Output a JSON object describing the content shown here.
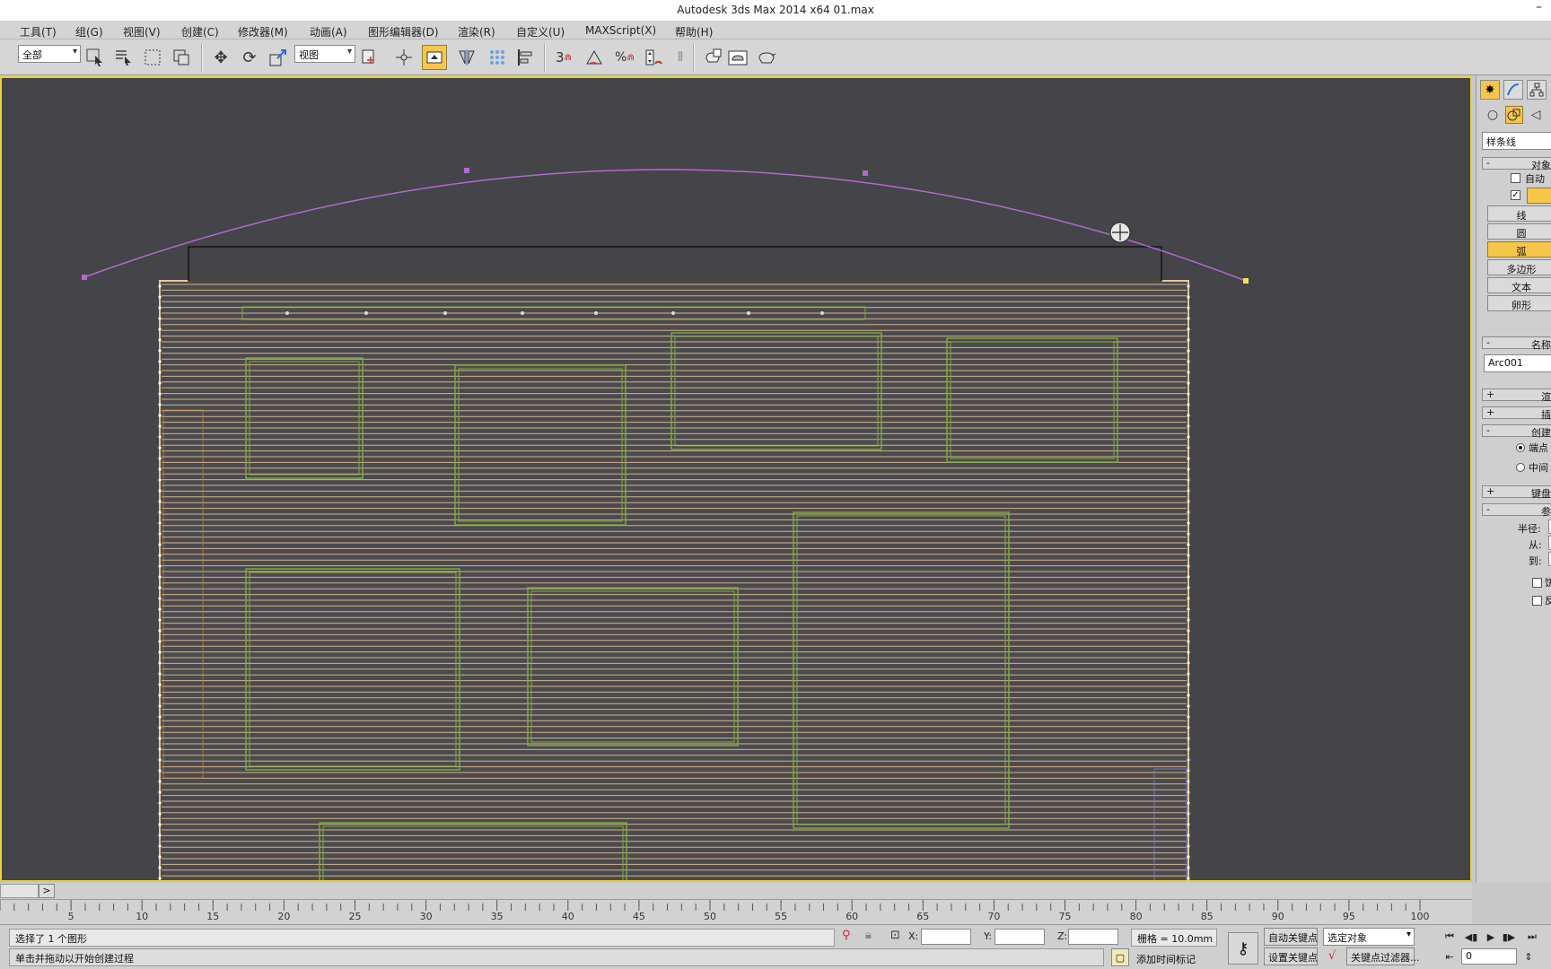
{
  "titlebar": {
    "title": "Autodesk 3ds Max  2014 x64      01.max",
    "minimize": "–"
  },
  "menu": [
    "工具(T)",
    "组(G)",
    "视图(V)",
    "创建(C)",
    "修改器(M)",
    "动画(A)",
    "图形编辑器(D)",
    "渲染(R)",
    "自定义(U)",
    "MAXScript(X)",
    "帮助(H)"
  ],
  "toolbar": {
    "selection_filter": "全部",
    "ref_coord": "视图"
  },
  "command_panel": {
    "category": "样条线",
    "rollout_object_type": "对象",
    "auto_grid": "自动",
    "buttons": [
      "线",
      "圆",
      "弧",
      "多边形",
      "文本",
      "卵形"
    ],
    "active_button": "弧",
    "rollout_name_color": "名称",
    "object_name": "Arc001",
    "rollout_render": "渲",
    "rollout_interp": "插",
    "rollout_creation": "创建",
    "radio_endpoint": "端点",
    "radio_center": "中间",
    "rollout_keyboard": "键盘",
    "rollout_params": "参",
    "radius_label": "半径:",
    "from_label": "从:",
    "to_label": "到:",
    "pie_label": "饼",
    "reverse_label": "反"
  },
  "viewport": {
    "scroll_arrow": ">"
  },
  "timeline": {
    "ticks": [
      "5",
      "10",
      "15",
      "20",
      "25",
      "30",
      "35",
      "40",
      "45",
      "50",
      "55",
      "60",
      "65",
      "70",
      "75",
      "80",
      "85",
      "90",
      "95",
      "100"
    ]
  },
  "status": {
    "selection_info": "选择了 1 个图形",
    "prompt": "单击并拖动以开始创建过程",
    "x_label": "X:",
    "y_label": "Y:",
    "z_label": "Z:",
    "grid": "栅格 = 10.0mm",
    "auto_key": "自动关键点",
    "set_key": "设置关键点",
    "selected_objects": "选定对象",
    "key_filters": "关键点过滤器...",
    "add_time_tag": "添加时间标记",
    "frame": "0"
  },
  "colors": {
    "accent": "#f5c64a",
    "viewport_bg": "#454449",
    "arc": "#b06cc8",
    "wall_lines": "#e6c79a",
    "frames": "#7fae3a"
  }
}
